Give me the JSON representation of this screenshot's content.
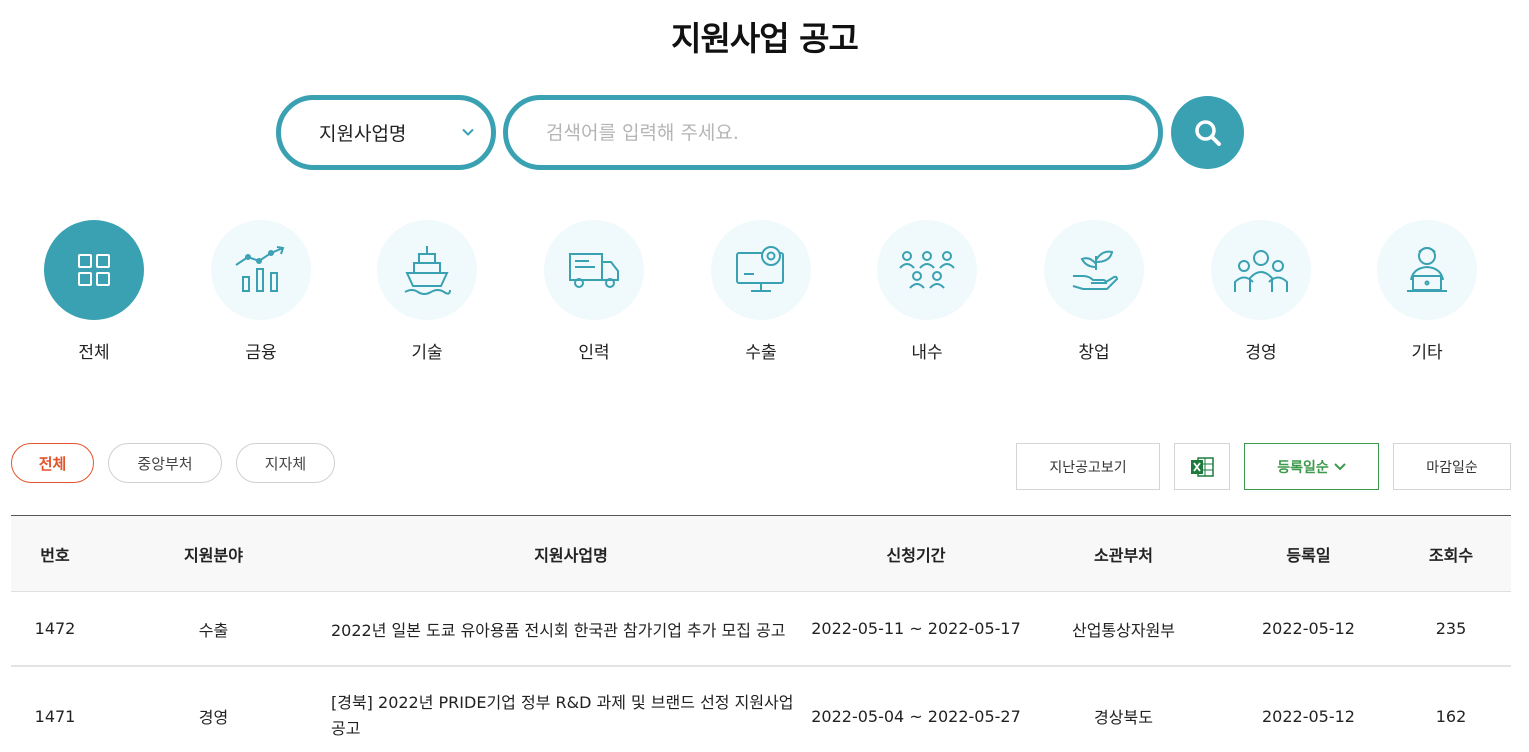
{
  "page": {
    "title": "지원사업 공고"
  },
  "search": {
    "select_value": "지원사업명",
    "placeholder": "검색어를 입력해 주세요."
  },
  "categories": [
    {
      "label": "전체",
      "icon": "grid-icon",
      "active": true
    },
    {
      "label": "금융",
      "icon": "chart-icon"
    },
    {
      "label": "기술",
      "icon": "ship-icon"
    },
    {
      "label": "인력",
      "icon": "truck-icon"
    },
    {
      "label": "수출",
      "icon": "monitor-gear-icon"
    },
    {
      "label": "내수",
      "icon": "people-icon"
    },
    {
      "label": "창업",
      "icon": "sprout-hand-icon"
    },
    {
      "label": "경영",
      "icon": "team-icon"
    },
    {
      "label": "기타",
      "icon": "laptop-user-icon"
    }
  ],
  "filters": {
    "all": "전체",
    "central": "중앙부처",
    "local": "지자체"
  },
  "actions": {
    "past": "지난공고보기",
    "excel_icon": "excel-icon",
    "sort_reg": "등록일순",
    "sort_deadline": "마감일순"
  },
  "table": {
    "headers": {
      "no": "번호",
      "field": "지원분야",
      "title": "지원사업명",
      "period": "신청기간",
      "dept": "소관부처",
      "date": "등록일",
      "views": "조회수"
    },
    "rows": [
      {
        "no": "1472",
        "field": "수출",
        "title": "2022년 일본 도쿄 유아용품 전시회 한국관 참가기업 추가 모집 공고",
        "period": "2022-05-11 ~ 2022-05-17",
        "dept": "산업통상자원부",
        "date": "2022-05-12",
        "views": "235"
      },
      {
        "no": "1471",
        "field": "경영",
        "title": "[경북] 2022년 PRIDE기업 정부 R&D 과제 및 브랜드 선정 지원사업 공고",
        "period": "2022-05-04 ~ 2022-05-27",
        "dept": "경상북도",
        "date": "2022-05-12",
        "views": "162"
      }
    ]
  },
  "colors": {
    "accent": "#3aa1b3",
    "active_filter": "#e2542b",
    "sort_green": "#3b9a4b",
    "excel_green": "#1e7a3c"
  }
}
